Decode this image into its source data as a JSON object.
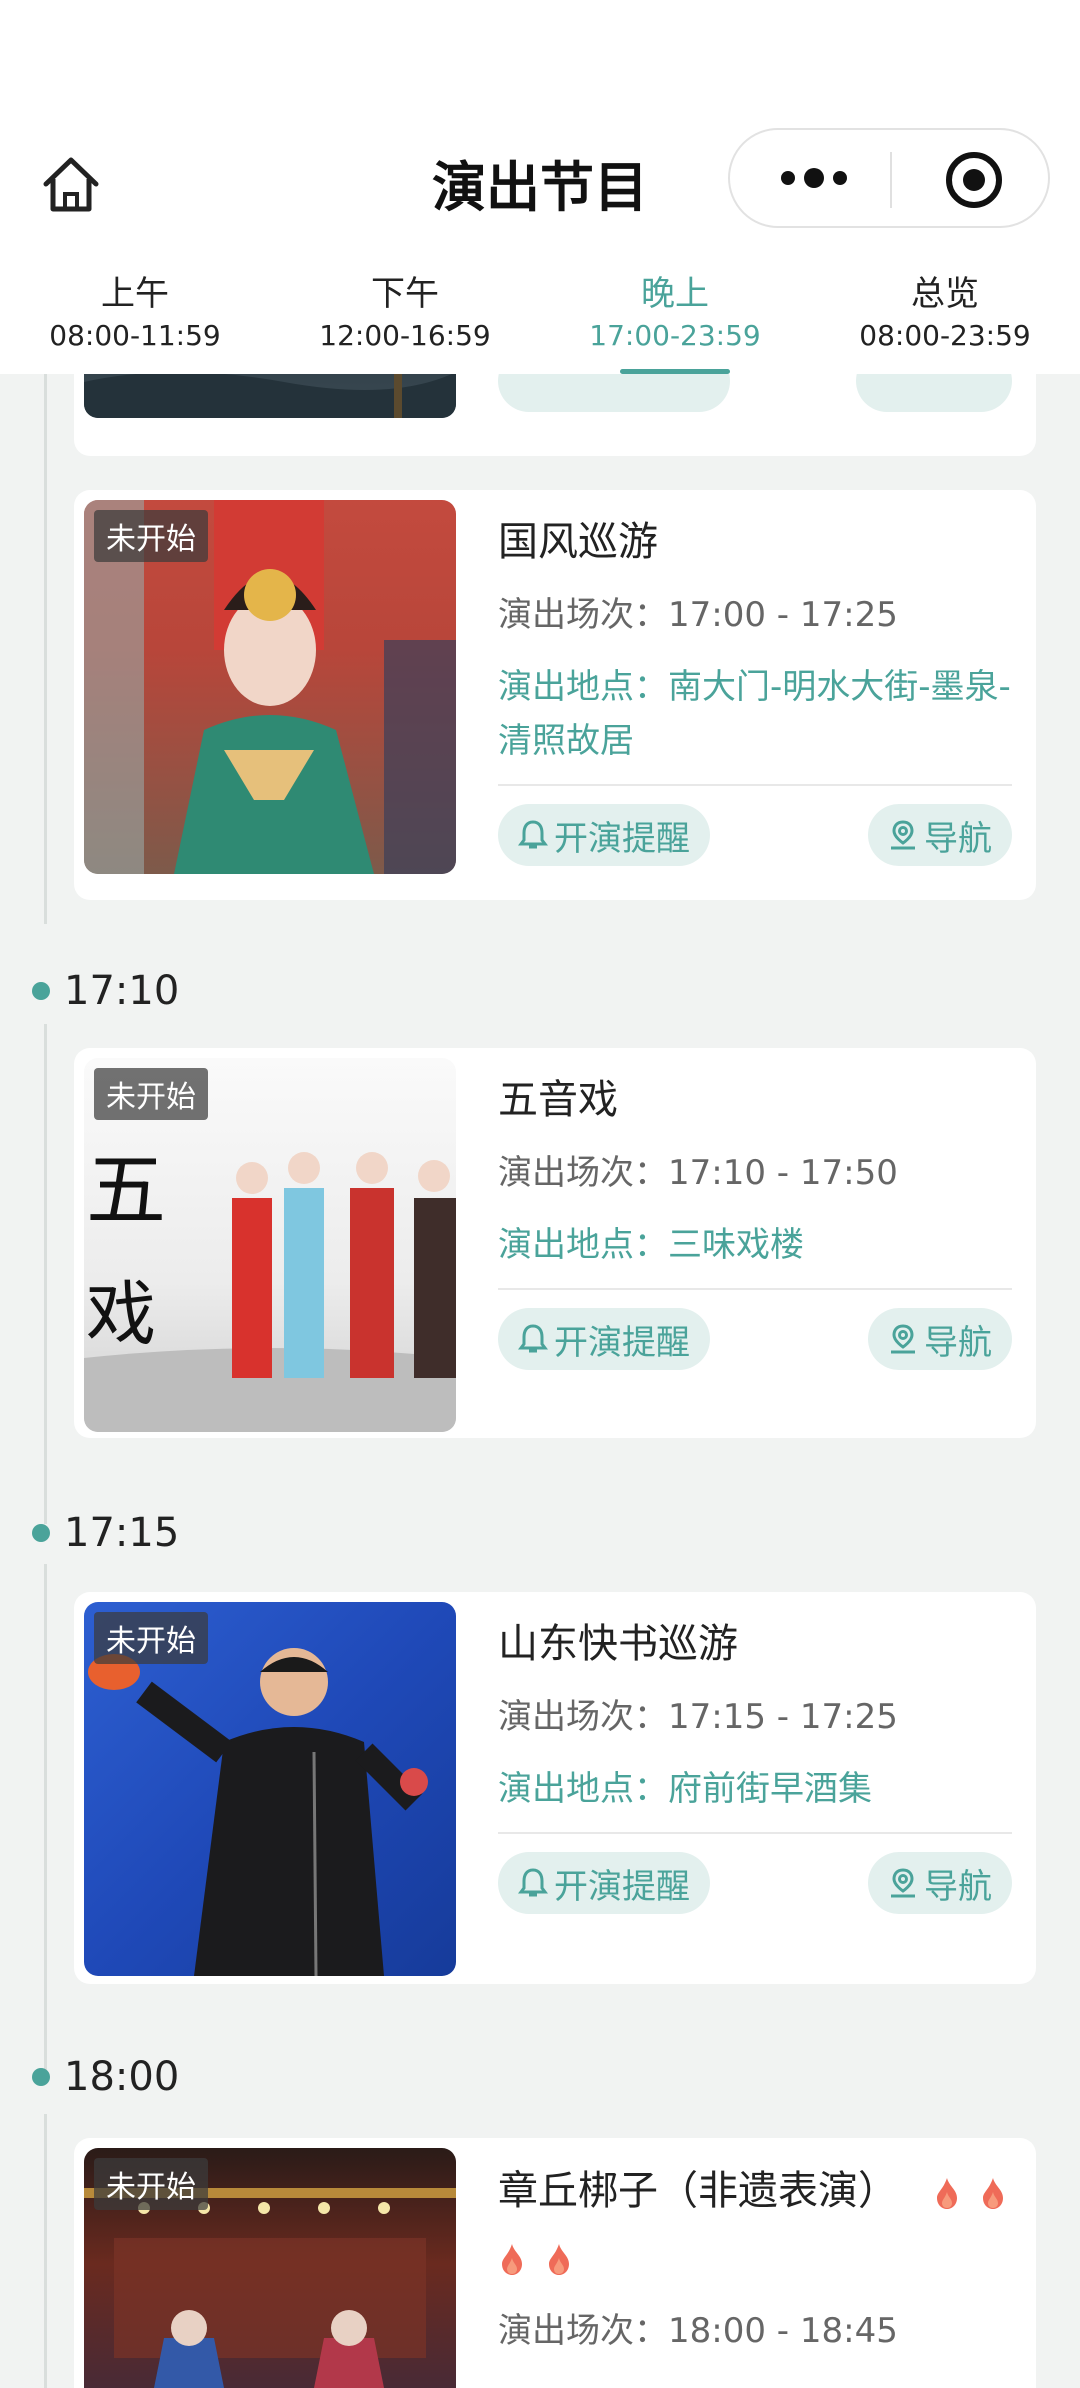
{
  "header": {
    "title": "演出节目"
  },
  "tabs": [
    {
      "label": "上午",
      "range": "08:00-11:59"
    },
    {
      "label": "下午",
      "range": "12:00-16:59"
    },
    {
      "label": "晚上",
      "range": "17:00-23:59"
    },
    {
      "label": "总览",
      "range": "08:00-23:59"
    }
  ],
  "active_tab": 2,
  "common": {
    "time_prefix": "演出场次：",
    "place_prefix": "演出地点：",
    "remind_label": "开演提醒",
    "nav_label": "导航",
    "status_badge": "未开始"
  },
  "groups": [
    {
      "time": "17:10"
    },
    {
      "time": "17:15"
    },
    {
      "time": "18:00"
    }
  ],
  "shows": [
    {
      "title": "国风巡游",
      "session": "17:00 - 17:25",
      "place": "南大门-明水大街-墨泉-清照故居"
    },
    {
      "title": "五音戏",
      "session": "17:10 - 17:50",
      "place": "三味戏楼"
    },
    {
      "title": "山东快书巡游",
      "session": "17:15 - 17:25",
      "place": "府前街早酒集"
    },
    {
      "title": "章丘梆子（非遗表演）",
      "session": "18:00 - 18:45",
      "place": ""
    }
  ],
  "colors": {
    "accent": "#4aa39a",
    "background": "#f1f3f2"
  }
}
